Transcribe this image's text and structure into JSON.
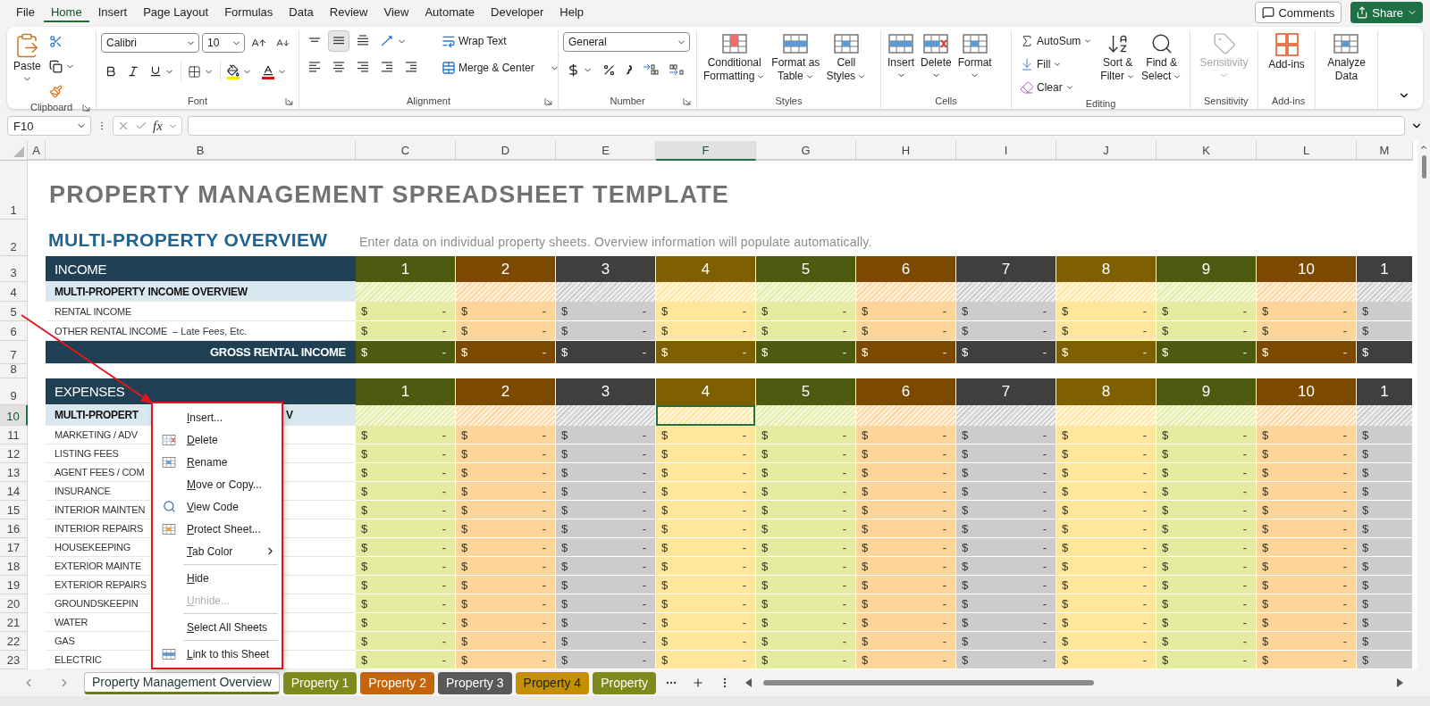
{
  "menu_tabs": [
    {
      "label": "File",
      "selected": false
    },
    {
      "label": "Home",
      "selected": true
    },
    {
      "label": "Insert",
      "selected": false
    },
    {
      "label": "Page Layout",
      "selected": false
    },
    {
      "label": "Formulas",
      "selected": false
    },
    {
      "label": "Data",
      "selected": false
    },
    {
      "label": "Review",
      "selected": false
    },
    {
      "label": "View",
      "selected": false
    },
    {
      "label": "Automate",
      "selected": false
    },
    {
      "label": "Developer",
      "selected": false
    },
    {
      "label": "Help",
      "selected": false
    }
  ],
  "top_buttons": {
    "comments": "Comments",
    "share": "Share"
  },
  "ribbon": {
    "clipboard": {
      "label": "Clipboard",
      "paste": "Paste"
    },
    "font": {
      "label": "Font",
      "family": "Calibri",
      "size": "10"
    },
    "alignment": {
      "label": "Alignment",
      "wrap": "Wrap Text",
      "merge": "Merge & Center",
      "valign_buttons": [
        {
          "selected": false
        },
        {
          "selected": true
        },
        {
          "selected": false
        }
      ]
    },
    "number": {
      "label": "Number",
      "format": "General"
    },
    "styles": {
      "label": "Styles",
      "buttons": [
        {
          "lines": [
            "Conditional",
            "Formatting"
          ],
          "kind": "conditional",
          "dropdown": true,
          "disabled": false
        },
        {
          "lines": [
            "Format as",
            "Table"
          ],
          "kind": "table",
          "dropdown": true,
          "disabled": false
        },
        {
          "lines": [
            "Cell",
            "Styles"
          ],
          "kind": "cellstyles",
          "dropdown": true,
          "disabled": false
        }
      ]
    },
    "cells": {
      "label": "Cells",
      "buttons": [
        {
          "lines": [
            "Insert"
          ],
          "kind": "insert",
          "dropdown": true,
          "disabled": false
        },
        {
          "lines": [
            "Delete"
          ],
          "kind": "delete",
          "dropdown": true,
          "disabled": false
        },
        {
          "lines": [
            "Format"
          ],
          "kind": "format",
          "dropdown": true,
          "disabled": false
        }
      ]
    },
    "editing": {
      "label": "Editing",
      "small": [
        {
          "label": "AutoSum",
          "kind": "sum"
        },
        {
          "label": "Fill",
          "kind": "fill"
        },
        {
          "label": "Clear",
          "kind": "clear"
        }
      ],
      "buttons": [
        {
          "lines": [
            "Sort &",
            "Filter"
          ],
          "kind": "sort",
          "dropdown": true,
          "disabled": false
        },
        {
          "lines": [
            "Find &",
            "Select"
          ],
          "kind": "find",
          "dropdown": true,
          "disabled": false
        }
      ]
    },
    "sensitivity": {
      "label": "Sensitivity",
      "buttons": [
        {
          "lines": [
            "Sensitivity"
          ],
          "kind": "sensitivity",
          "dropdown": true,
          "disabled": true
        }
      ]
    },
    "addins": {
      "label": "Add-ins",
      "buttons": [
        {
          "lines": [
            "Add-ins"
          ],
          "kind": "addins",
          "dropdown": false,
          "disabled": false
        }
      ]
    },
    "analyze": {
      "buttons": [
        {
          "lines": [
            "Analyze",
            "Data"
          ],
          "kind": "analyze",
          "dropdown": false,
          "disabled": false
        }
      ]
    }
  },
  "formula_bar": {
    "name_box": "F10",
    "fx": "fx"
  },
  "column_headers": [
    {
      "label": "A",
      "selected": false
    },
    {
      "label": "B",
      "selected": false
    },
    {
      "label": "C",
      "selected": false
    },
    {
      "label": "D",
      "selected": false
    },
    {
      "label": "E",
      "selected": false
    },
    {
      "label": "F",
      "selected": true
    },
    {
      "label": "G",
      "selected": false
    },
    {
      "label": "H",
      "selected": false
    },
    {
      "label": "I",
      "selected": false
    },
    {
      "label": "J",
      "selected": false
    },
    {
      "label": "K",
      "selected": false
    },
    {
      "label": "L",
      "selected": false
    },
    {
      "label": "M",
      "selected": false
    }
  ],
  "row_headers": [
    {
      "label": "1",
      "selected": false
    },
    {
      "label": "2",
      "selected": false
    },
    {
      "label": "3",
      "selected": false
    },
    {
      "label": "4",
      "selected": false
    },
    {
      "label": "5",
      "selected": false
    },
    {
      "label": "6",
      "selected": false
    },
    {
      "label": "7",
      "selected": false
    },
    {
      "label": "8",
      "selected": false
    },
    {
      "label": "9",
      "selected": false
    },
    {
      "label": "10",
      "selected": true
    },
    {
      "label": "11",
      "selected": false
    },
    {
      "label": "12",
      "selected": false
    },
    {
      "label": "13",
      "selected": false
    },
    {
      "label": "14",
      "selected": false
    },
    {
      "label": "15",
      "selected": false
    },
    {
      "label": "16",
      "selected": false
    },
    {
      "label": "17",
      "selected": false
    },
    {
      "label": "18",
      "selected": false
    },
    {
      "label": "19",
      "selected": false
    },
    {
      "label": "20",
      "selected": false
    },
    {
      "label": "21",
      "selected": false
    },
    {
      "label": "22",
      "selected": false
    },
    {
      "label": "23",
      "selected": false
    }
  ],
  "columns": [
    {
      "color": "#4f5a11",
      "light": {
        "color": "#e2eb9f"
      }
    },
    {
      "color": "#7b4a00",
      "light": {
        "color": "#fdd59a"
      }
    },
    {
      "color": "#3f3f3f",
      "light": {
        "color": "#cccccc"
      }
    },
    {
      "color": "#7f6000",
      "light": {
        "color": "#ffe69b"
      }
    },
    {
      "color": "#4f5a11",
      "light": {
        "color": "#e2eb9f"
      }
    },
    {
      "color": "#7b4a00",
      "light": {
        "color": "#fdd59a"
      }
    },
    {
      "color": "#3f3f3f",
      "light": {
        "color": "#cccccc"
      }
    },
    {
      "color": "#7f6000",
      "light": {
        "color": "#ffe69b"
      }
    },
    {
      "color": "#4f5a11",
      "light": {
        "color": "#e2eb9f"
      }
    },
    {
      "color": "#7b4a00",
      "light": {
        "color": "#fdd59a"
      }
    },
    {
      "color": "#3f3f3f",
      "light": {
        "color": "#cccccc"
      }
    }
  ],
  "title": "PROPERTY MANAGEMENT SPREADSHEET TEMPLATE",
  "overview": {
    "heading": "MULTI-PROPERTY OVERVIEW",
    "note": "Enter data on individual property sheets. Overview information will populate automatically."
  },
  "income": {
    "header": "INCOME",
    "numbers": [
      "1",
      "2",
      "3",
      "4",
      "5",
      "6",
      "7",
      "8",
      "9",
      "10",
      "1"
    ],
    "subheader": "MULTI-PROPERTY INCOME OVERVIEW",
    "rows": [
      {
        "label": "RENTAL INCOME",
        "cells": [
          [
            "$",
            "-"
          ],
          [
            "$",
            "-"
          ],
          [
            "$",
            "-"
          ],
          [
            "$",
            "-"
          ],
          [
            "$",
            "-"
          ],
          [
            "$",
            "-"
          ],
          [
            "$",
            "-"
          ],
          [
            "$",
            "-"
          ],
          [
            "$",
            "-"
          ],
          [
            "$",
            "-"
          ],
          [
            "$"
          ]
        ]
      },
      {
        "label": "OTHER RENTAL INCOME",
        "note": "– Late Fees, Etc.",
        "cells": [
          [
            "$",
            "-"
          ],
          [
            "$",
            "-"
          ],
          [
            "$",
            "-"
          ],
          [
            "$",
            "-"
          ],
          [
            "$",
            "-"
          ],
          [
            "$",
            "-"
          ],
          [
            "$",
            "-"
          ],
          [
            "$",
            "-"
          ],
          [
            "$",
            "-"
          ],
          [
            "$",
            "-"
          ],
          [
            "$"
          ]
        ]
      }
    ],
    "total": {
      "label": "GROSS RENTAL INCOME",
      "cells": [
        [
          "$",
          "-"
        ],
        [
          "$",
          "-"
        ],
        [
          "$",
          "-"
        ],
        [
          "$",
          "-"
        ],
        [
          "$",
          "-"
        ],
        [
          "$",
          "-"
        ],
        [
          "$",
          "-"
        ],
        [
          "$",
          "-"
        ],
        [
          "$",
          "-"
        ],
        [
          "$",
          "-"
        ],
        [
          "$"
        ]
      ]
    }
  },
  "expenses": {
    "header": "EXPENSES",
    "numbers": [
      "1",
      "2",
      "3",
      "4",
      "5",
      "6",
      "7",
      "8",
      "9",
      "10",
      "1"
    ],
    "subheader": "MULTI-PROPERT",
    "subheader_tail": "V",
    "rows": [
      {
        "label": "MARKETING / ADV",
        "cells": [
          [
            "$",
            "-"
          ],
          [
            "$",
            "-"
          ],
          [
            "$",
            "-"
          ],
          [
            "$",
            "-"
          ],
          [
            "$",
            "-"
          ],
          [
            "$",
            "-"
          ],
          [
            "$",
            "-"
          ],
          [
            "$",
            "-"
          ],
          [
            "$",
            "-"
          ],
          [
            "$",
            "-"
          ],
          [
            "$"
          ]
        ]
      },
      {
        "label": "LISTING FEES",
        "cells": [
          [
            "$",
            "-"
          ],
          [
            "$",
            "-"
          ],
          [
            "$",
            "-"
          ],
          [
            "$",
            "-"
          ],
          [
            "$",
            "-"
          ],
          [
            "$",
            "-"
          ],
          [
            "$",
            "-"
          ],
          [
            "$",
            "-"
          ],
          [
            "$",
            "-"
          ],
          [
            "$",
            "-"
          ],
          [
            "$"
          ]
        ]
      },
      {
        "label": "AGENT FEES / COM",
        "cells": [
          [
            "$",
            "-"
          ],
          [
            "$",
            "-"
          ],
          [
            "$",
            "-"
          ],
          [
            "$",
            "-"
          ],
          [
            "$",
            "-"
          ],
          [
            "$",
            "-"
          ],
          [
            "$",
            "-"
          ],
          [
            "$",
            "-"
          ],
          [
            "$",
            "-"
          ],
          [
            "$",
            "-"
          ],
          [
            "$"
          ]
        ]
      },
      {
        "label": "INSURANCE",
        "cells": [
          [
            "$",
            "-"
          ],
          [
            "$",
            "-"
          ],
          [
            "$",
            "-"
          ],
          [
            "$",
            "-"
          ],
          [
            "$",
            "-"
          ],
          [
            "$",
            "-"
          ],
          [
            "$",
            "-"
          ],
          [
            "$",
            "-"
          ],
          [
            "$",
            "-"
          ],
          [
            "$",
            "-"
          ],
          [
            "$"
          ]
        ]
      },
      {
        "label": "INTERIOR MAINTEN",
        "cells": [
          [
            "$",
            "-"
          ],
          [
            "$",
            "-"
          ],
          [
            "$",
            "-"
          ],
          [
            "$",
            "-"
          ],
          [
            "$",
            "-"
          ],
          [
            "$",
            "-"
          ],
          [
            "$",
            "-"
          ],
          [
            "$",
            "-"
          ],
          [
            "$",
            "-"
          ],
          [
            "$",
            "-"
          ],
          [
            "$"
          ]
        ]
      },
      {
        "label": "INTERIOR REPAIRS",
        "cells": [
          [
            "$",
            "-"
          ],
          [
            "$",
            "-"
          ],
          [
            "$",
            "-"
          ],
          [
            "$",
            "-"
          ],
          [
            "$",
            "-"
          ],
          [
            "$",
            "-"
          ],
          [
            "$",
            "-"
          ],
          [
            "$",
            "-"
          ],
          [
            "$",
            "-"
          ],
          [
            "$",
            "-"
          ],
          [
            "$"
          ]
        ]
      },
      {
        "label": "HOUSEKEEPING",
        "cells": [
          [
            "$",
            "-"
          ],
          [
            "$",
            "-"
          ],
          [
            "$",
            "-"
          ],
          [
            "$",
            "-"
          ],
          [
            "$",
            "-"
          ],
          [
            "$",
            "-"
          ],
          [
            "$",
            "-"
          ],
          [
            "$",
            "-"
          ],
          [
            "$",
            "-"
          ],
          [
            "$",
            "-"
          ],
          [
            "$"
          ]
        ]
      },
      {
        "label": "EXTERIOR MAINTE",
        "cells": [
          [
            "$",
            "-"
          ],
          [
            "$",
            "-"
          ],
          [
            "$",
            "-"
          ],
          [
            "$",
            "-"
          ],
          [
            "$",
            "-"
          ],
          [
            "$",
            "-"
          ],
          [
            "$",
            "-"
          ],
          [
            "$",
            "-"
          ],
          [
            "$",
            "-"
          ],
          [
            "$",
            "-"
          ],
          [
            "$"
          ]
        ]
      },
      {
        "label": "EXTERIOR REPAIRS",
        "cells": [
          [
            "$",
            "-"
          ],
          [
            "$",
            "-"
          ],
          [
            "$",
            "-"
          ],
          [
            "$",
            "-"
          ],
          [
            "$",
            "-"
          ],
          [
            "$",
            "-"
          ],
          [
            "$",
            "-"
          ],
          [
            "$",
            "-"
          ],
          [
            "$",
            "-"
          ],
          [
            "$",
            "-"
          ],
          [
            "$"
          ]
        ]
      },
      {
        "label": "GROUNDSKEEPIN",
        "cells": [
          [
            "$",
            "-"
          ],
          [
            "$",
            "-"
          ],
          [
            "$",
            "-"
          ],
          [
            "$",
            "-"
          ],
          [
            "$",
            "-"
          ],
          [
            "$",
            "-"
          ],
          [
            "$",
            "-"
          ],
          [
            "$",
            "-"
          ],
          [
            "$",
            "-"
          ],
          [
            "$",
            "-"
          ],
          [
            "$"
          ]
        ]
      },
      {
        "label": "WATER",
        "cells": [
          [
            "$",
            "-"
          ],
          [
            "$",
            "-"
          ],
          [
            "$",
            "-"
          ],
          [
            "$",
            "-"
          ],
          [
            "$",
            "-"
          ],
          [
            "$",
            "-"
          ],
          [
            "$",
            "-"
          ],
          [
            "$",
            "-"
          ],
          [
            "$",
            "-"
          ],
          [
            "$",
            "-"
          ],
          [
            "$"
          ]
        ]
      },
      {
        "label": "GAS",
        "cells": [
          [
            "$",
            "-"
          ],
          [
            "$",
            "-"
          ],
          [
            "$",
            "-"
          ],
          [
            "$",
            "-"
          ],
          [
            "$",
            "-"
          ],
          [
            "$",
            "-"
          ],
          [
            "$",
            "-"
          ],
          [
            "$",
            "-"
          ],
          [
            "$",
            "-"
          ],
          [
            "$",
            "-"
          ],
          [
            "$"
          ]
        ]
      },
      {
        "label": "ELECTRIC",
        "cells": [
          [
            "$",
            "-"
          ],
          [
            "$",
            "-"
          ],
          [
            "$",
            "-"
          ],
          [
            "$",
            "-"
          ],
          [
            "$",
            "-"
          ],
          [
            "$",
            "-"
          ],
          [
            "$",
            "-"
          ],
          [
            "$",
            "-"
          ],
          [
            "$",
            "-"
          ],
          [
            "$",
            "-"
          ],
          [
            "$"
          ]
        ]
      }
    ]
  },
  "context_menu": [
    {
      "kind": "item",
      "label": "Insert...",
      "disabled": false,
      "submenu": false
    },
    {
      "kind": "item",
      "label": "Delete",
      "disabled": false,
      "submenu": false
    },
    {
      "kind": "item",
      "label": "Rename",
      "disabled": false,
      "submenu": false
    },
    {
      "kind": "item",
      "label": "Move or Copy...",
      "disabled": false,
      "submenu": false
    },
    {
      "kind": "item",
      "label": "View Code",
      "disabled": false,
      "submenu": false
    },
    {
      "kind": "item",
      "label": "Protect Sheet...",
      "disabled": false,
      "submenu": false
    },
    {
      "kind": "item",
      "label": "Tab Color",
      "disabled": false,
      "submenu": true
    },
    {
      "kind": "separator"
    },
    {
      "kind": "item",
      "label": "Hide",
      "disabled": false,
      "submenu": false
    },
    {
      "kind": "item",
      "label": "Unhide...",
      "disabled": true,
      "submenu": false
    },
    {
      "kind": "separator"
    },
    {
      "kind": "item",
      "label": "Select All Sheets",
      "disabled": false,
      "submenu": false
    },
    {
      "kind": "separator"
    },
    {
      "kind": "item",
      "label": "Link to this Sheet",
      "disabled": false,
      "submenu": false
    }
  ],
  "sheet_tabs": [
    {
      "label": "Property Management Overview",
      "selected": true
    },
    {
      "label": "Property 1",
      "selected": false,
      "color": "#7d8a1c"
    },
    {
      "label": "Property 2",
      "selected": false,
      "color": "#c4650c"
    },
    {
      "label": "Property 3",
      "selected": false,
      "color": "#595959"
    },
    {
      "label": "Property 4",
      "selected": false,
      "color": "#c49000"
    },
    {
      "label": "Property",
      "selected": false,
      "color": "#7d8a1c"
    }
  ]
}
